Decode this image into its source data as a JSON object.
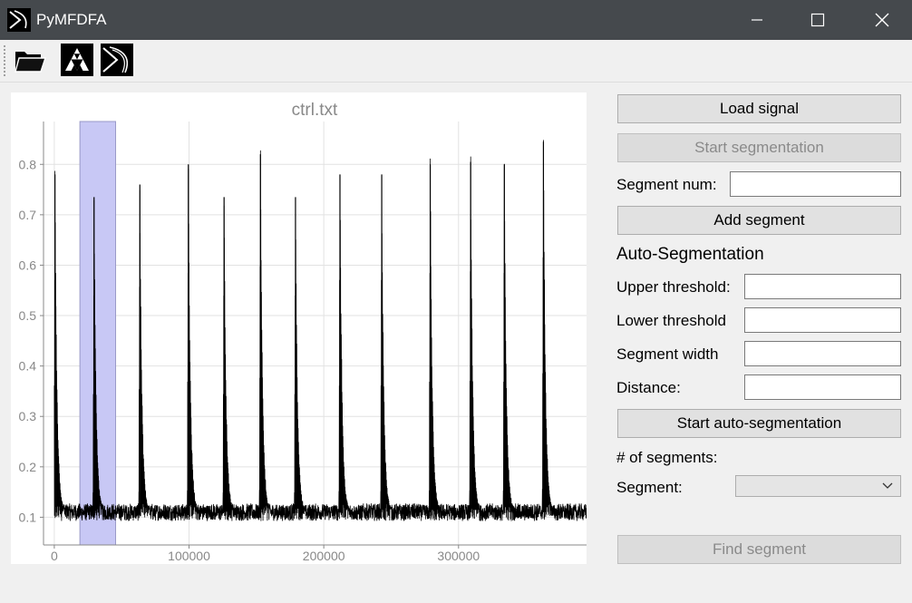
{
  "window": {
    "title": "PyMFDFA",
    "minimize_icon": "minimize-icon",
    "maximize_icon": "maximize-icon",
    "close_icon": "close-icon"
  },
  "toolbar": {
    "items": [
      {
        "icon": "folder-open-icon"
      },
      {
        "icon": "sierpinski-fractal-icon"
      },
      {
        "icon": "app-logo-icon"
      }
    ]
  },
  "plot": {
    "title": "ctrl.txt",
    "selection_color": "#c8c8f5",
    "signal_color": "#000000"
  },
  "panel": {
    "load_signal": "Load signal",
    "start_segmentation": "Start segmentation",
    "segment_num_label": "Segment num:",
    "segment_num_value": "",
    "add_segment": "Add segment",
    "auto_segmentation_title": "Auto-Segmentation",
    "upper_threshold_label": "Upper threshold:",
    "upper_threshold_value": "",
    "lower_threshold_label": "Lower threshold",
    "lower_threshold_value": "",
    "segment_width_label": "Segment width",
    "segment_width_value": "",
    "distance_label": "Distance:",
    "distance_value": "",
    "start_auto_segmentation": "Start auto-segmentation",
    "num_segments_label": "# of segments:",
    "segment_label": "Segment:",
    "segment_selected": "",
    "find_segment": "Find segment"
  },
  "chart_data": {
    "type": "line",
    "title": "ctrl.txt",
    "xlabel": "",
    "ylabel": "",
    "xlim": [
      -8000,
      395000
    ],
    "ylim": [
      0.045,
      0.885
    ],
    "x_ticks": [
      0,
      100000,
      200000,
      300000
    ],
    "x_tick_labels": [
      "0",
      "100000",
      "200000",
      "300000"
    ],
    "y_ticks": [
      0.1,
      0.2,
      0.3,
      0.4,
      0.5,
      0.6,
      0.7,
      0.8
    ],
    "y_tick_labels": [
      "0.1",
      "0.2",
      "0.3",
      "0.4",
      "0.5",
      "0.6",
      "0.7",
      "0.8"
    ],
    "grid": true,
    "baseline": 0.11,
    "peaks": [
      {
        "x": 500,
        "y": 0.78
      },
      {
        "x": 29500,
        "y": 0.735
      },
      {
        "x": 63500,
        "y": 0.76
      },
      {
        "x": 99500,
        "y": 0.8
      },
      {
        "x": 126000,
        "y": 0.735
      },
      {
        "x": 153000,
        "y": 0.82
      },
      {
        "x": 179000,
        "y": 0.735
      },
      {
        "x": 212000,
        "y": 0.78
      },
      {
        "x": 243000,
        "y": 0.78
      },
      {
        "x": 279000,
        "y": 0.8
      },
      {
        "x": 309000,
        "y": 0.805
      },
      {
        "x": 334000,
        "y": 0.8
      },
      {
        "x": 363000,
        "y": 0.845
      }
    ],
    "selected_region": [
      19000,
      45500
    ]
  }
}
